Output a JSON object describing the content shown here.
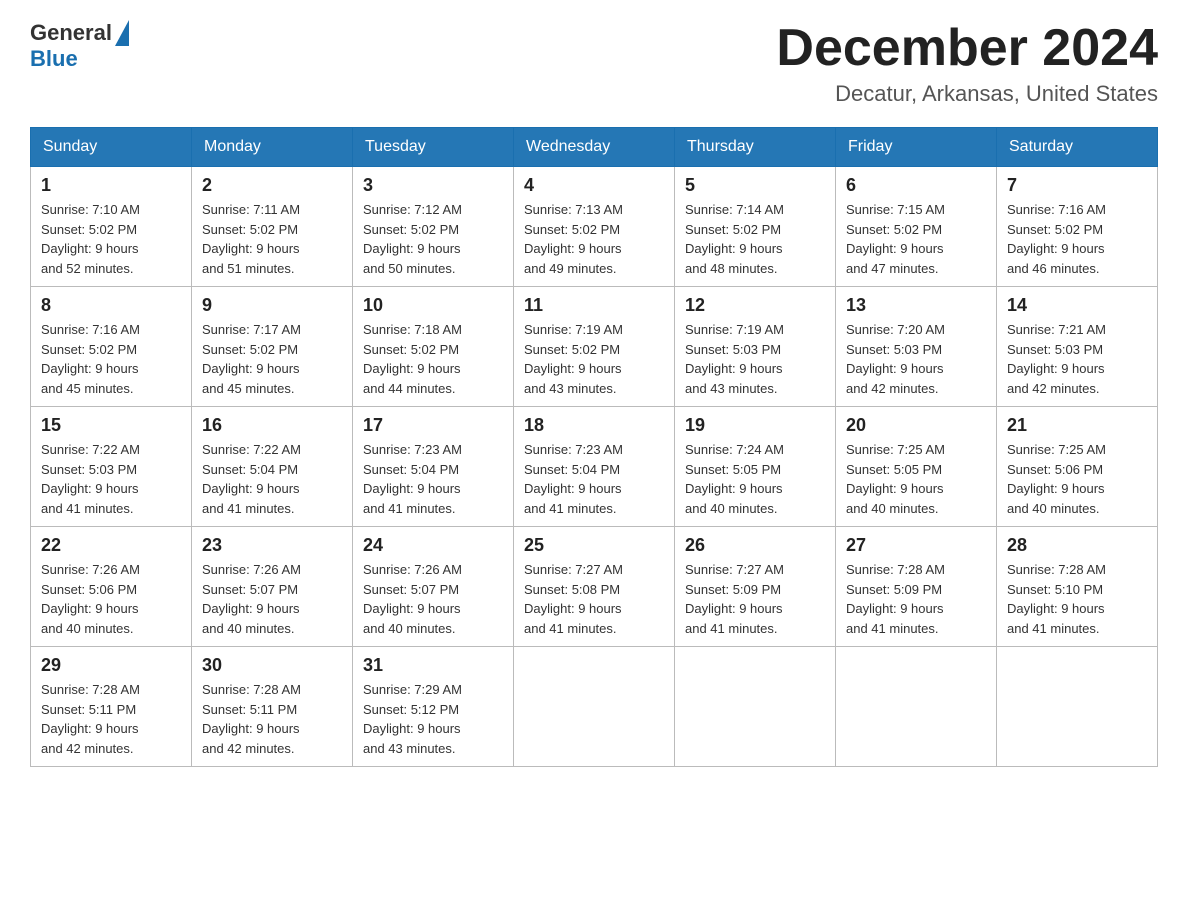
{
  "header": {
    "logo_general": "General",
    "logo_blue": "Blue",
    "month_title": "December 2024",
    "location": "Decatur, Arkansas, United States"
  },
  "days_of_week": [
    "Sunday",
    "Monday",
    "Tuesday",
    "Wednesday",
    "Thursday",
    "Friday",
    "Saturday"
  ],
  "weeks": [
    [
      {
        "day": "1",
        "sunrise": "7:10 AM",
        "sunset": "5:02 PM",
        "daylight": "9 hours and 52 minutes."
      },
      {
        "day": "2",
        "sunrise": "7:11 AM",
        "sunset": "5:02 PM",
        "daylight": "9 hours and 51 minutes."
      },
      {
        "day": "3",
        "sunrise": "7:12 AM",
        "sunset": "5:02 PM",
        "daylight": "9 hours and 50 minutes."
      },
      {
        "day": "4",
        "sunrise": "7:13 AM",
        "sunset": "5:02 PM",
        "daylight": "9 hours and 49 minutes."
      },
      {
        "day": "5",
        "sunrise": "7:14 AM",
        "sunset": "5:02 PM",
        "daylight": "9 hours and 48 minutes."
      },
      {
        "day": "6",
        "sunrise": "7:15 AM",
        "sunset": "5:02 PM",
        "daylight": "9 hours and 47 minutes."
      },
      {
        "day": "7",
        "sunrise": "7:16 AM",
        "sunset": "5:02 PM",
        "daylight": "9 hours and 46 minutes."
      }
    ],
    [
      {
        "day": "8",
        "sunrise": "7:16 AM",
        "sunset": "5:02 PM",
        "daylight": "9 hours and 45 minutes."
      },
      {
        "day": "9",
        "sunrise": "7:17 AM",
        "sunset": "5:02 PM",
        "daylight": "9 hours and 45 minutes."
      },
      {
        "day": "10",
        "sunrise": "7:18 AM",
        "sunset": "5:02 PM",
        "daylight": "9 hours and 44 minutes."
      },
      {
        "day": "11",
        "sunrise": "7:19 AM",
        "sunset": "5:02 PM",
        "daylight": "9 hours and 43 minutes."
      },
      {
        "day": "12",
        "sunrise": "7:19 AM",
        "sunset": "5:03 PM",
        "daylight": "9 hours and 43 minutes."
      },
      {
        "day": "13",
        "sunrise": "7:20 AM",
        "sunset": "5:03 PM",
        "daylight": "9 hours and 42 minutes."
      },
      {
        "day": "14",
        "sunrise": "7:21 AM",
        "sunset": "5:03 PM",
        "daylight": "9 hours and 42 minutes."
      }
    ],
    [
      {
        "day": "15",
        "sunrise": "7:22 AM",
        "sunset": "5:03 PM",
        "daylight": "9 hours and 41 minutes."
      },
      {
        "day": "16",
        "sunrise": "7:22 AM",
        "sunset": "5:04 PM",
        "daylight": "9 hours and 41 minutes."
      },
      {
        "day": "17",
        "sunrise": "7:23 AM",
        "sunset": "5:04 PM",
        "daylight": "9 hours and 41 minutes."
      },
      {
        "day": "18",
        "sunrise": "7:23 AM",
        "sunset": "5:04 PM",
        "daylight": "9 hours and 41 minutes."
      },
      {
        "day": "19",
        "sunrise": "7:24 AM",
        "sunset": "5:05 PM",
        "daylight": "9 hours and 40 minutes."
      },
      {
        "day": "20",
        "sunrise": "7:25 AM",
        "sunset": "5:05 PM",
        "daylight": "9 hours and 40 minutes."
      },
      {
        "day": "21",
        "sunrise": "7:25 AM",
        "sunset": "5:06 PM",
        "daylight": "9 hours and 40 minutes."
      }
    ],
    [
      {
        "day": "22",
        "sunrise": "7:26 AM",
        "sunset": "5:06 PM",
        "daylight": "9 hours and 40 minutes."
      },
      {
        "day": "23",
        "sunrise": "7:26 AM",
        "sunset": "5:07 PM",
        "daylight": "9 hours and 40 minutes."
      },
      {
        "day": "24",
        "sunrise": "7:26 AM",
        "sunset": "5:07 PM",
        "daylight": "9 hours and 40 minutes."
      },
      {
        "day": "25",
        "sunrise": "7:27 AM",
        "sunset": "5:08 PM",
        "daylight": "9 hours and 41 minutes."
      },
      {
        "day": "26",
        "sunrise": "7:27 AM",
        "sunset": "5:09 PM",
        "daylight": "9 hours and 41 minutes."
      },
      {
        "day": "27",
        "sunrise": "7:28 AM",
        "sunset": "5:09 PM",
        "daylight": "9 hours and 41 minutes."
      },
      {
        "day": "28",
        "sunrise": "7:28 AM",
        "sunset": "5:10 PM",
        "daylight": "9 hours and 41 minutes."
      }
    ],
    [
      {
        "day": "29",
        "sunrise": "7:28 AM",
        "sunset": "5:11 PM",
        "daylight": "9 hours and 42 minutes."
      },
      {
        "day": "30",
        "sunrise": "7:28 AM",
        "sunset": "5:11 PM",
        "daylight": "9 hours and 42 minutes."
      },
      {
        "day": "31",
        "sunrise": "7:29 AM",
        "sunset": "5:12 PM",
        "daylight": "9 hours and 43 minutes."
      },
      null,
      null,
      null,
      null
    ]
  ],
  "labels": {
    "sunrise": "Sunrise: ",
    "sunset": "Sunset: ",
    "daylight": "Daylight: "
  }
}
